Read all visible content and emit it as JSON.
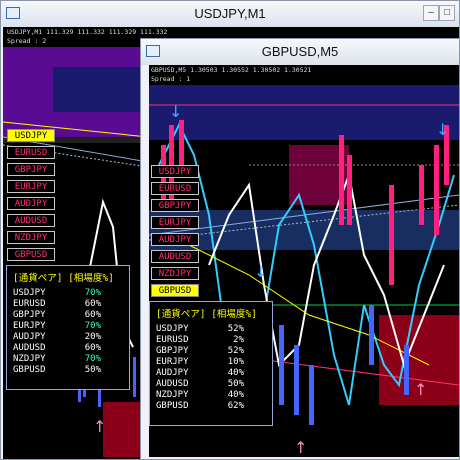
{
  "windows": {
    "back": {
      "title": "USDJPY,M1",
      "info_line": "USDJPY,M1  111.329 111.332 111.329 111.332",
      "spread": "Spread : 2",
      "pair_buttons": [
        "USDJPY",
        "EURUSD",
        "GBPJPY",
        "EURJPY",
        "AUDJPY",
        "AUDUSD",
        "NZDJPY",
        "GBPUSD"
      ],
      "selected_pair": "USDJPY",
      "panel": {
        "header_pair": "[通貨ペア]",
        "header_level": "[相場度%]",
        "rows": [
          {
            "pair": "USDJPY",
            "value": "70%",
            "color": "#33ffcc"
          },
          {
            "pair": "EURUSD",
            "value": "60%",
            "color": "#ffffff"
          },
          {
            "pair": "GBPJPY",
            "value": "60%",
            "color": "#ffffff"
          },
          {
            "pair": "EURJPY",
            "value": "70%",
            "color": "#33ffcc"
          },
          {
            "pair": "AUDJPY",
            "value": "20%",
            "color": "#ffffff"
          },
          {
            "pair": "AUDUSD",
            "value": "60%",
            "color": "#ffffff"
          },
          {
            "pair": "NZDJPY",
            "value": "70%",
            "color": "#33ffcc"
          },
          {
            "pair": "GBPUSD",
            "value": "50%",
            "color": "#ffffff"
          }
        ]
      }
    },
    "front": {
      "title": "GBPUSD,M5",
      "info_line": "GBPUSD,M5  1.30503 1.30552 1.30502 1.30521",
      "spread": "Spread : 1",
      "pair_buttons": [
        "USDJPY",
        "EURUSD",
        "GBPJPY",
        "EURJPY",
        "AUDJPY",
        "AUDUSD",
        "NZDJPY",
        "GBPUSD"
      ],
      "selected_pair": "GBPUSD",
      "panel": {
        "header_pair": "[通貨ペア]",
        "header_level": "[相場度%]",
        "rows": [
          {
            "pair": "USDJPY",
            "value": "52%",
            "color": "#ffffff"
          },
          {
            "pair": "EURUSD",
            "value": "2%",
            "color": "#ffffff"
          },
          {
            "pair": "GBPJPY",
            "value": "52%",
            "color": "#ffffff"
          },
          {
            "pair": "EURJPY",
            "value": "10%",
            "color": "#ffffff"
          },
          {
            "pair": "AUDJPY",
            "value": "40%",
            "color": "#ffffff"
          },
          {
            "pair": "AUDUSD",
            "value": "50%",
            "color": "#ffffff"
          },
          {
            "pair": "NZDJPY",
            "value": "40%",
            "color": "#ffffff"
          },
          {
            "pair": "GBPUSD",
            "value": "62%",
            "color": "#ffffff"
          }
        ]
      }
    }
  },
  "colors": {
    "pink": "#ff3070",
    "yellow": "#ffff00",
    "cyan": "#33ffcc",
    "navy": "#1a1a6e"
  }
}
